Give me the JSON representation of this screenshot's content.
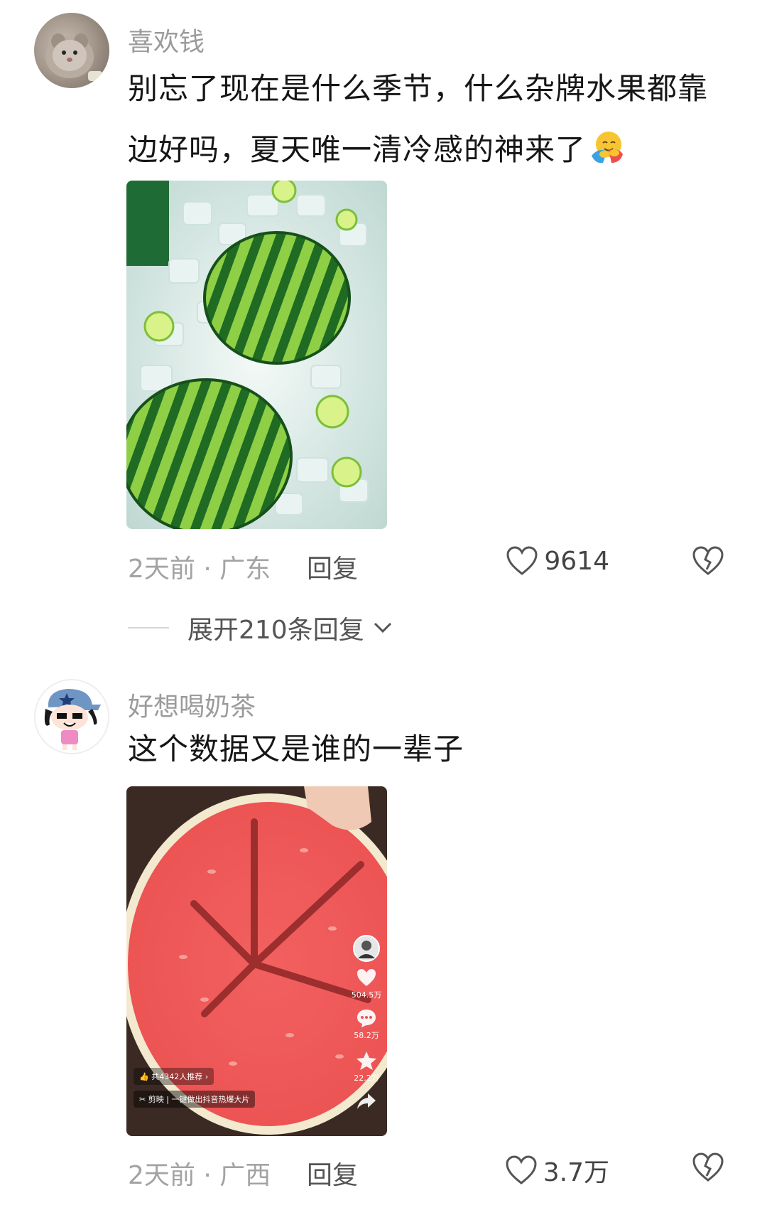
{
  "comments": [
    {
      "username": "喜欢钱",
      "text": "别忘了现在是什么季节，什么杂牌水果都靠边好吗，夏天唯一清冷感的神来了",
      "time_location": "2天前 · 广东",
      "reply_label": "回复",
      "likes": "9614",
      "expand_label": "展开210条回复"
    },
    {
      "username": "好想喝奶茶",
      "text": "这个数据又是谁的一辈子",
      "time_location": "2天前 · 广西",
      "reply_label": "回复",
      "likes": "3.7万",
      "video": {
        "likes": "504.5万",
        "comments": "58.2万",
        "favorites": "22.2万",
        "recommend": "共4342人推荐",
        "jianying": "剪映",
        "jianying_slogan": "一键做出抖音热爆大片"
      }
    }
  ]
}
